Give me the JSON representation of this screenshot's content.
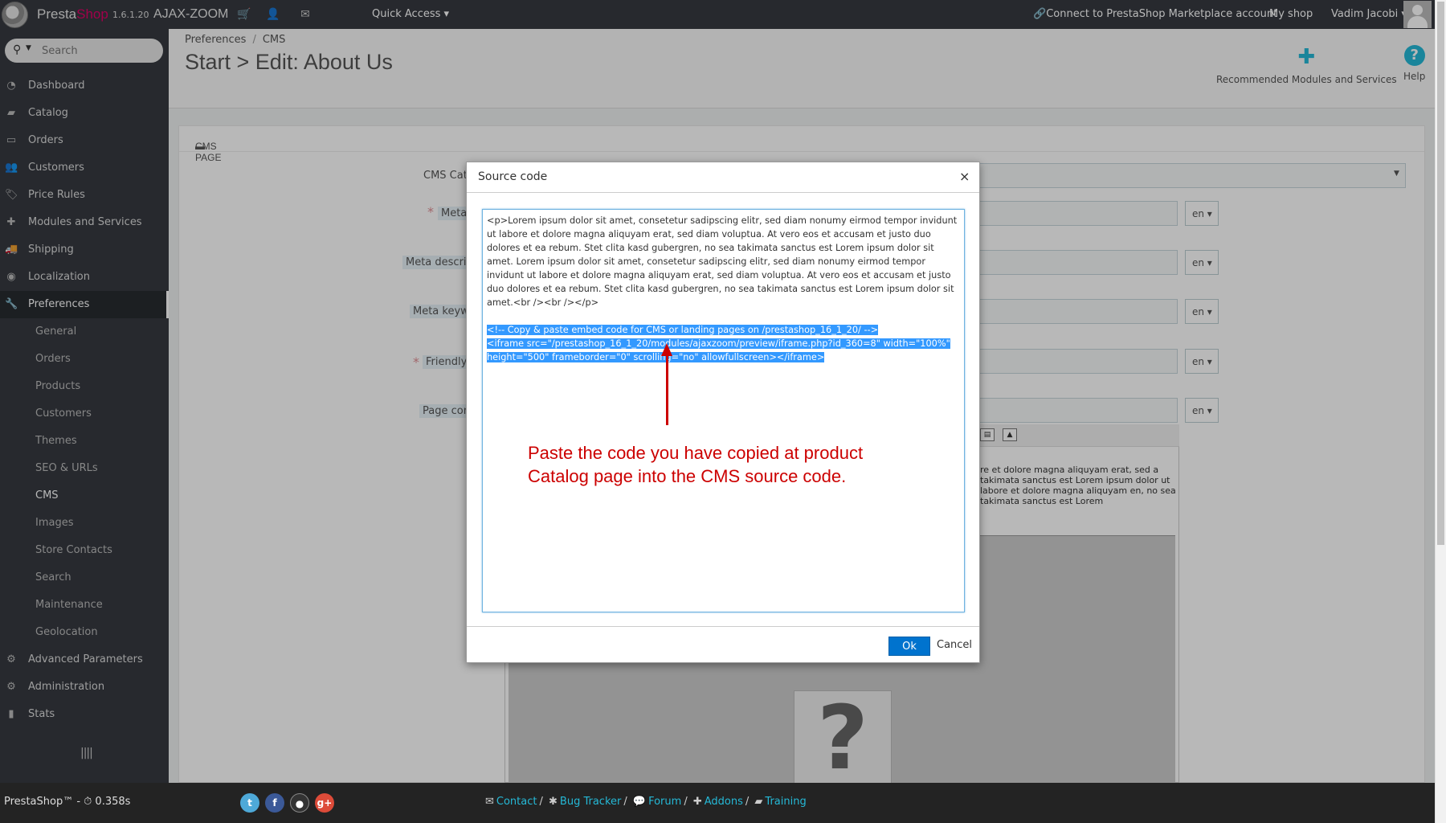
{
  "topbar": {
    "brand_presta": "Presta",
    "brand_shop": "Shop",
    "version": "1.6.1.20",
    "store_name": "AJAX-ZOOM",
    "quick_access": "Quick Access ▾",
    "connect": "Connect to PrestaShop Marketplace account",
    "my_shop": "My shop",
    "user": "Vadim Jacobi ▾"
  },
  "sidebar": {
    "search_placeholder": "Search",
    "items": [
      {
        "label": "Dashboard",
        "icon": "dashboard-icon"
      },
      {
        "label": "Catalog",
        "icon": "book-icon"
      },
      {
        "label": "Orders",
        "icon": "credit-card-icon"
      },
      {
        "label": "Customers",
        "icon": "users-icon"
      },
      {
        "label": "Price Rules",
        "icon": "tags-icon"
      },
      {
        "label": "Modules and Services",
        "icon": "puzzle-icon"
      },
      {
        "label": "Shipping",
        "icon": "truck-icon"
      },
      {
        "label": "Localization",
        "icon": "globe-icon"
      },
      {
        "label": "Preferences",
        "icon": "wrench-icon"
      }
    ],
    "subitems": [
      "General",
      "Orders",
      "Products",
      "Customers",
      "Themes",
      "SEO & URLs",
      "CMS",
      "Images",
      "Store Contacts",
      "Search",
      "Maintenance",
      "Geolocation"
    ],
    "bottom_items": [
      {
        "label": "Advanced Parameters",
        "icon": "cogs-icon"
      },
      {
        "label": "Administration",
        "icon": "cog-icon"
      },
      {
        "label": "Stats",
        "icon": "bar-chart-icon"
      }
    ],
    "collapse_glyph": "||||"
  },
  "header": {
    "breadcrumb": [
      "Preferences",
      "CMS"
    ],
    "title": "Start > Edit: About Us",
    "recommended": "Recommended Modules and Services",
    "help": "Help"
  },
  "panel": {
    "heading": "CMS PAGE",
    "labels": [
      "CMS Cate",
      "Meta",
      "Meta descrip",
      "Meta keyw",
      "Friendly",
      "Page con"
    ],
    "lang": "en ▾",
    "editor_text": "re et dolore magna aliquyam erat, sed a takimata sanctus est Lorem ipsum dolor ut labore et dolore magna aliquyam en, no sea takimata sanctus est Lorem"
  },
  "modal": {
    "title": "Source code",
    "close": "×",
    "source_text": "<p>Lorem ipsum dolor sit amet, consetetur sadipscing elitr, sed diam nonumy eirmod tempor invidunt ut labore et dolore magna aliquyam erat, sed diam voluptua. At vero eos et accusam et justo duo dolores et ea rebum. Stet clita kasd gubergren, no sea takimata sanctus est Lorem ipsum dolor sit amet. Lorem ipsum dolor sit amet, consetetur sadipscing elitr, sed diam nonumy eirmod tempor invidunt ut labore et dolore magna aliquyam erat, sed diam voluptua. At vero eos et accusam et justo duo dolores et ea rebum. Stet clita kasd gubergren, no sea takimata sanctus est Lorem ipsum dolor sit amet.<br /><br /></p>",
    "selected_line1": "<!-- Copy & paste embed code for CMS or landing pages on /prestashop_16_1_20/ -->",
    "selected_line2": "<iframe src=\"/prestashop_16_1_20/modules/ajaxzoom/preview/iframe.php?id_360=8\" width=\"100%\" height=\"500\" frameborder=\"0\" scrolling=\"no\" allowfullscreen></iframe>",
    "annotation": "Paste the code you have copied at product Catalog page into the CMS source code.",
    "ok": "Ok",
    "cancel": "Cancel"
  },
  "footer": {
    "prestashop": "PrestaShop™ - ⏱ 0.358s",
    "links": [
      "Contact",
      "Bug Tracker",
      "Forum",
      "Addons",
      "Training"
    ],
    "social": [
      {
        "icon": "twitter-icon",
        "color": "#4ea9d8",
        "glyph": "t"
      },
      {
        "icon": "facebook-icon",
        "color": "#3b5998",
        "glyph": "f"
      },
      {
        "icon": "github-icon",
        "color": "#333333",
        "glyph": "●"
      },
      {
        "icon": "google-plus-icon",
        "color": "#dd4b39",
        "glyph": "g+"
      }
    ]
  },
  "colors": {
    "accent": "#25b9d7",
    "annotation": "#cc0000",
    "primary_button": "#0073ce",
    "sidebar": "#363a41"
  }
}
